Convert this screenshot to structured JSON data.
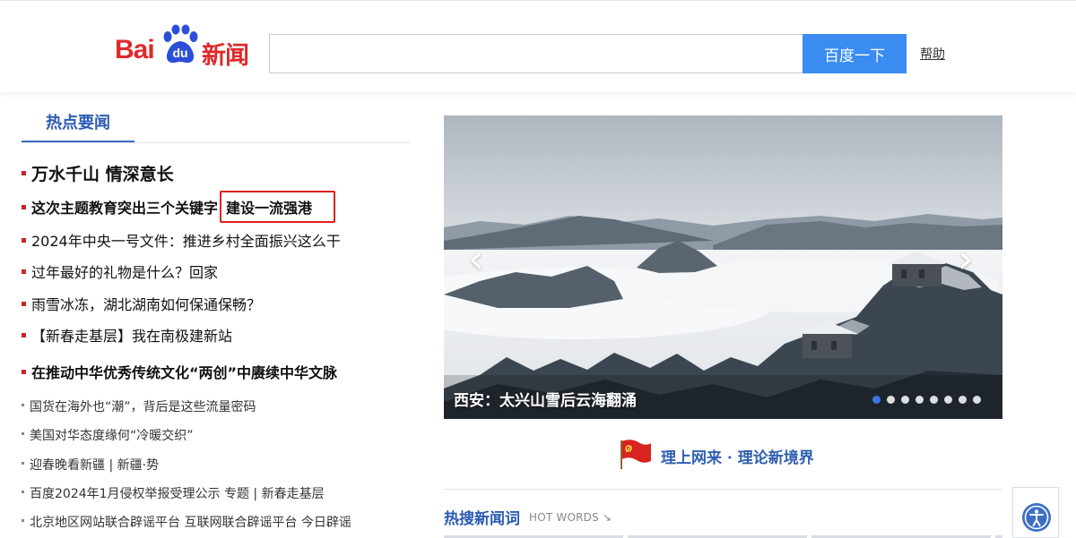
{
  "header": {
    "logo_left": "Bai",
    "logo_paw": "du",
    "logo_right": "新闻",
    "search_value": "",
    "search_button": "百度一下",
    "help_link": "帮助"
  },
  "hot_news": {
    "tab_label": "热点要闻",
    "items": [
      {
        "text": "万水千山 情深意长",
        "style": "headline"
      },
      {
        "text": "这次主题教育突出三个关键字",
        "highlight": "建设一流强港",
        "style": "boldmed"
      },
      {
        "text": "2024年中央一号文件：推进乡村全面振兴这么干",
        "style": "normal"
      },
      {
        "text": "过年最好的礼物是什么？回家",
        "style": "normal"
      },
      {
        "text": "雨雪冰冻，湖北湖南如何保通保畅？",
        "style": "normal"
      },
      {
        "text": "【新春走基层】我在南极建新站",
        "style": "normal"
      },
      {
        "text": "在推动中华优秀传统文化“两创”中赓续中华文脉",
        "style": "boldmed"
      },
      {
        "text": "国货在海外也“潮”，背后是这些流量密码",
        "style": "small"
      },
      {
        "text": "美国对华态度缘何“冷暖交织”",
        "style": "small"
      },
      {
        "text": "迎春晚看新疆 | 新疆·势",
        "style": "small"
      },
      {
        "text": "百度2024年1月侵权举报受理公示 专题 | 新春走基层",
        "style": "small"
      },
      {
        "text": "北京地区网站联合辟谣平台 互联网联合辟谣平台 今日辟谣",
        "style": "small"
      }
    ]
  },
  "carousel": {
    "caption": "西安：太兴山雪后云海翻涌",
    "prev_icon": "chevron-left-icon",
    "next_icon": "chevron-right-icon",
    "prev_glyph": "‹",
    "next_glyph": "›",
    "slide_count": 8,
    "active_index": 0
  },
  "banner": {
    "text": "理上网来 · 理论新境界",
    "icon": "party-flag-icon"
  },
  "hot_words": {
    "title": "热搜新闻词",
    "subtitle": "HOT WORDS ↘"
  },
  "floating": {
    "icon": "accessibility-icon"
  },
  "colors": {
    "brand_red": "#de2a2a",
    "search_blue": "#3a8cf1",
    "title_blue": "#2c5bb4",
    "bullet_red": "#c9252b",
    "highlight_red": "#e02020"
  }
}
